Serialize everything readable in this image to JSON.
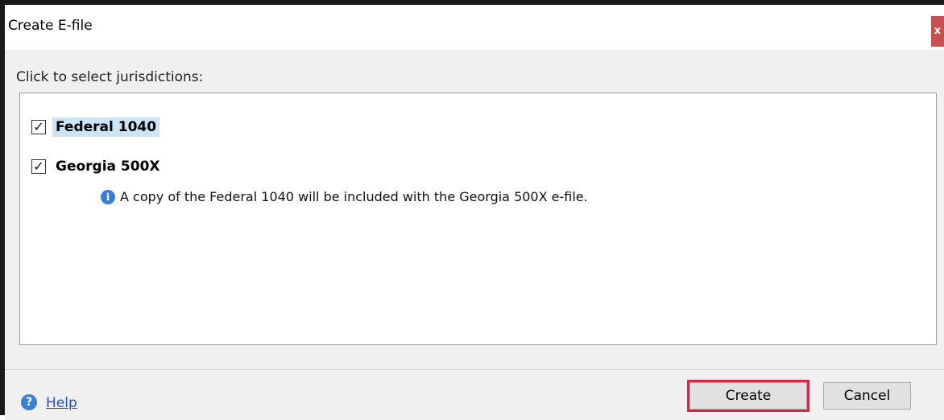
{
  "dialog": {
    "title": "Create E-file",
    "close_label": "x"
  },
  "instruction": "Click to select jurisdictions:",
  "jurisdictions": [
    {
      "label": "Federal 1040",
      "checked": true,
      "selected": true
    },
    {
      "label": "Georgia 500X",
      "checked": true,
      "selected": false
    }
  ],
  "info": {
    "icon": "info-icon",
    "text": "A copy of the Federal 1040 will be included with the Georgia 500X e-file."
  },
  "footer": {
    "help_icon": "help-icon",
    "help_label": "Help",
    "create_label": "Create",
    "cancel_label": "Cancel"
  },
  "colors": {
    "highlight_outline": "#d6294a",
    "selected_background": "#cce4f7",
    "link": "#1a4fd6",
    "close_button": "#c75050"
  }
}
